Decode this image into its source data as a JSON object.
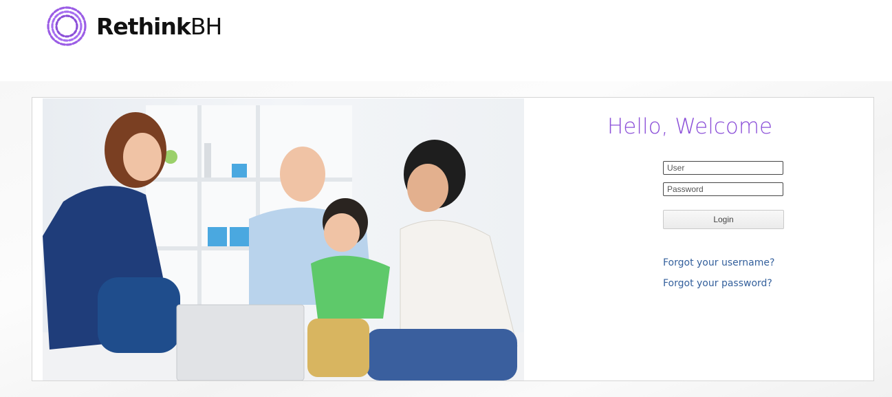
{
  "brand": {
    "name_bold": "Rethink",
    "name_thin": "BH",
    "accent_color": "#8b4fd8"
  },
  "hero_image": {
    "icon": "family-photo"
  },
  "login": {
    "heading": "Hello, Welcome",
    "user_placeholder": "User",
    "password_placeholder": "Password",
    "login_label": "Login",
    "forgot_username": "Forgot your username?",
    "forgot_password": "Forgot your password?",
    "link_color": "#34609c"
  }
}
